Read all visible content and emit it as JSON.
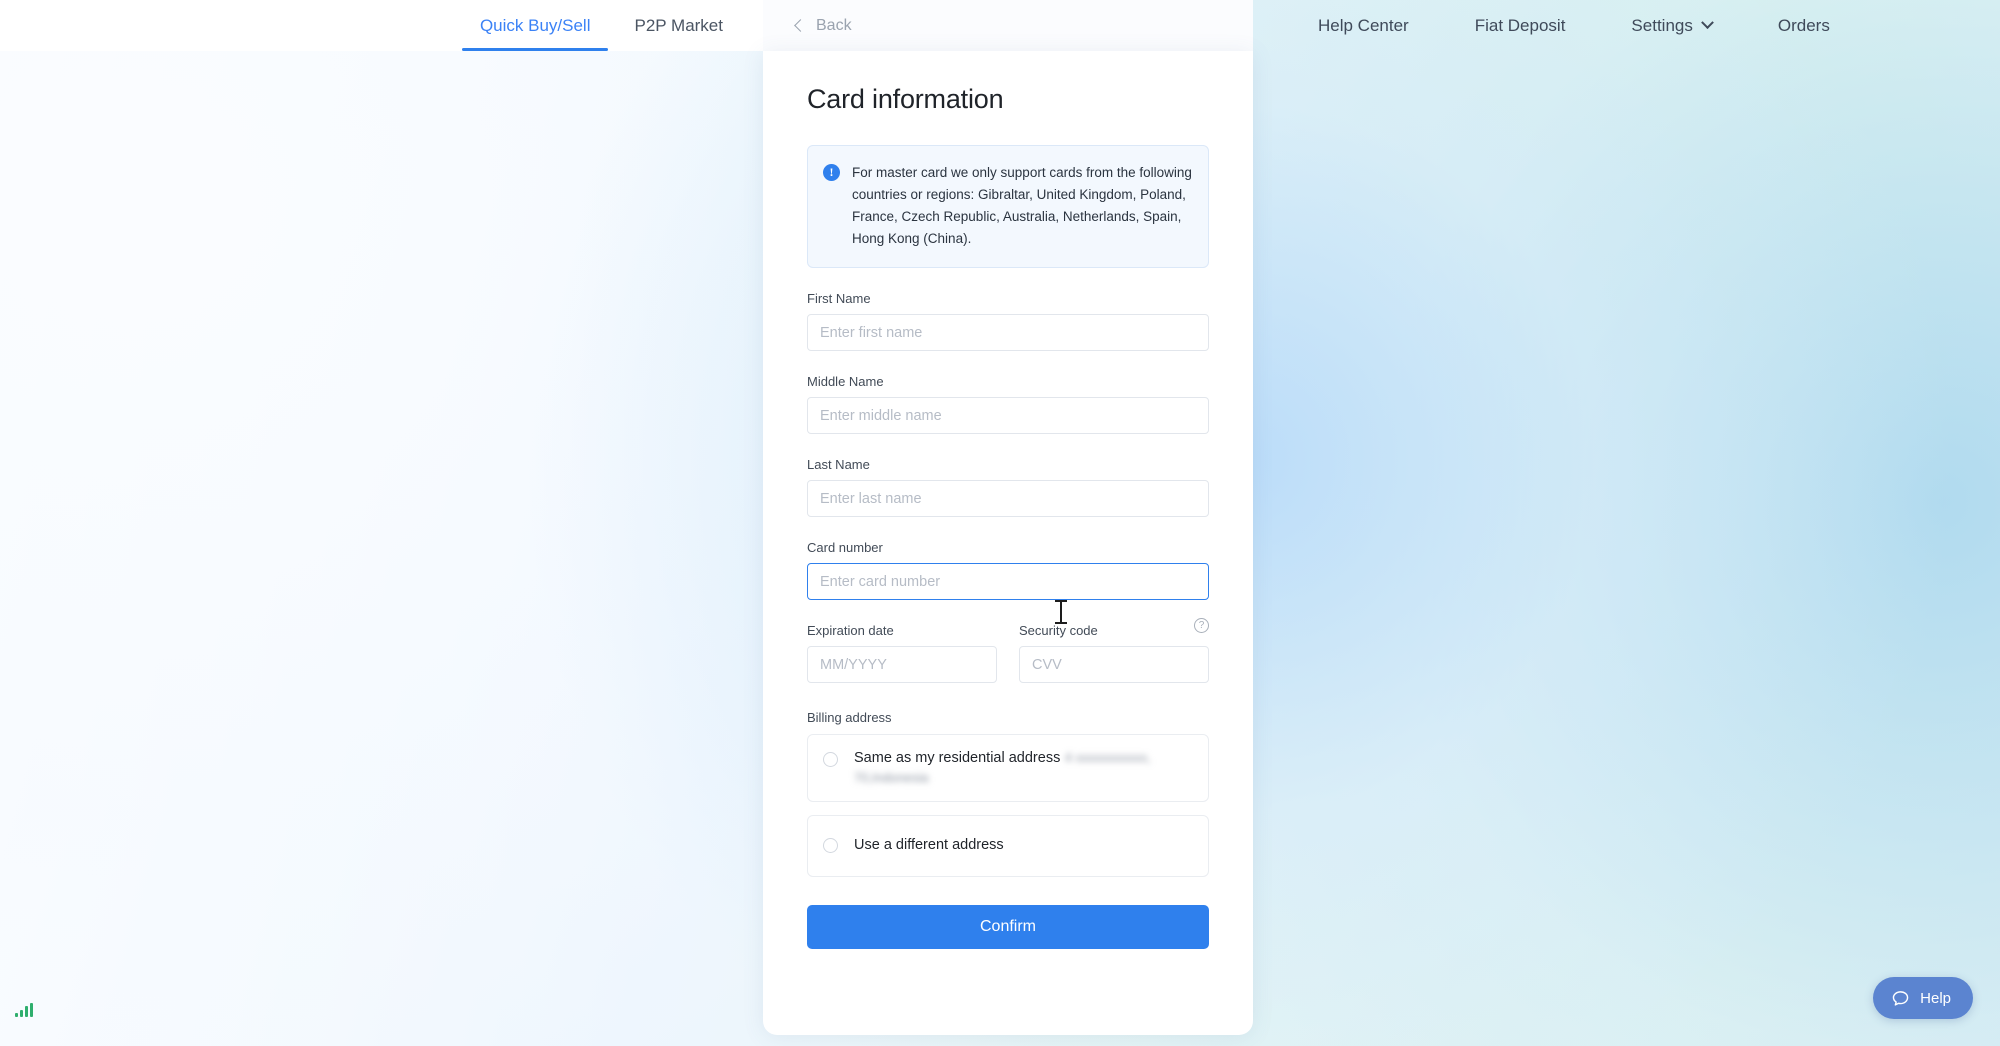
{
  "topbar": {
    "tabs": [
      {
        "label": "Quick Buy/Sell",
        "active": true
      },
      {
        "label": "P2P Market",
        "active": false
      }
    ],
    "back_label": "Back",
    "nav_items": [
      {
        "label": "Help Center",
        "has_chevron": false
      },
      {
        "label": "Fiat Deposit",
        "has_chevron": false
      },
      {
        "label": "Settings",
        "has_chevron": true
      },
      {
        "label": "Orders",
        "has_chevron": false
      }
    ]
  },
  "modal": {
    "title": "Card information",
    "banner": {
      "icon": "info-icon",
      "text": "For master card we only support cards from the following countries or regions: Gibraltar, United Kingdom, Poland, France, Czech Republic, Australia, Netherlands, Spain, Hong Kong (China)."
    },
    "fields": {
      "first_name": {
        "label": "First Name",
        "placeholder": "Enter first name",
        "value": ""
      },
      "middle_name": {
        "label": "Middle Name",
        "placeholder": "Enter middle name",
        "value": ""
      },
      "last_name": {
        "label": "Last Name",
        "placeholder": "Enter last name",
        "value": ""
      },
      "card_number": {
        "label": "Card number",
        "placeholder": "Enter card number",
        "value": "",
        "focused": true
      },
      "expiration_date": {
        "label": "Expiration date",
        "placeholder": "MM/YYYY",
        "value": ""
      },
      "security_code": {
        "label": "Security code",
        "placeholder": "CVV",
        "value": ""
      }
    },
    "security_help_icon": "question-mark-icon",
    "billing": {
      "label": "Billing address",
      "options": [
        {
          "title": "Same as my residential address",
          "subtitle": " ",
          "selected": false
        },
        {
          "title": "Use a different address",
          "subtitle": "",
          "selected": false
        }
      ]
    },
    "confirm_label": "Confirm"
  },
  "help_widget": {
    "label": "Help",
    "icon": "chat-bubble-icon"
  },
  "colors": {
    "accent_blue": "#2f80ed",
    "tab_active": "#3b82f6",
    "banner_bg": "#f3f8fe",
    "banner_border": "#dbe8f8",
    "help_widget_bg": "#5b84d0",
    "signal_green": "#2fae6d"
  }
}
